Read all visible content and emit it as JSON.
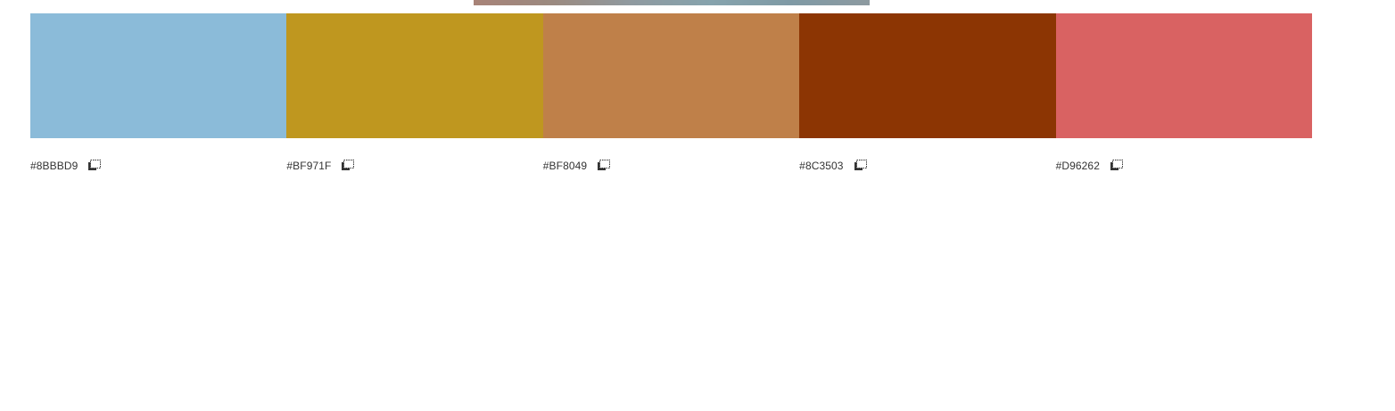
{
  "swatches": [
    {
      "hex": "#8BBBD9",
      "color": "#8BBBD9",
      "icon": "copy-icon"
    },
    {
      "hex": "#BF971F",
      "color": "#BF971F",
      "icon": "copy-icon"
    },
    {
      "hex": "#BF8049",
      "color": "#BF8049",
      "icon": "copy-icon"
    },
    {
      "hex": "#8C3503",
      "color": "#8C3503",
      "icon": "copy-icon"
    },
    {
      "hex": "#D96262",
      "color": "#D96262",
      "icon": "copy-icon"
    }
  ]
}
